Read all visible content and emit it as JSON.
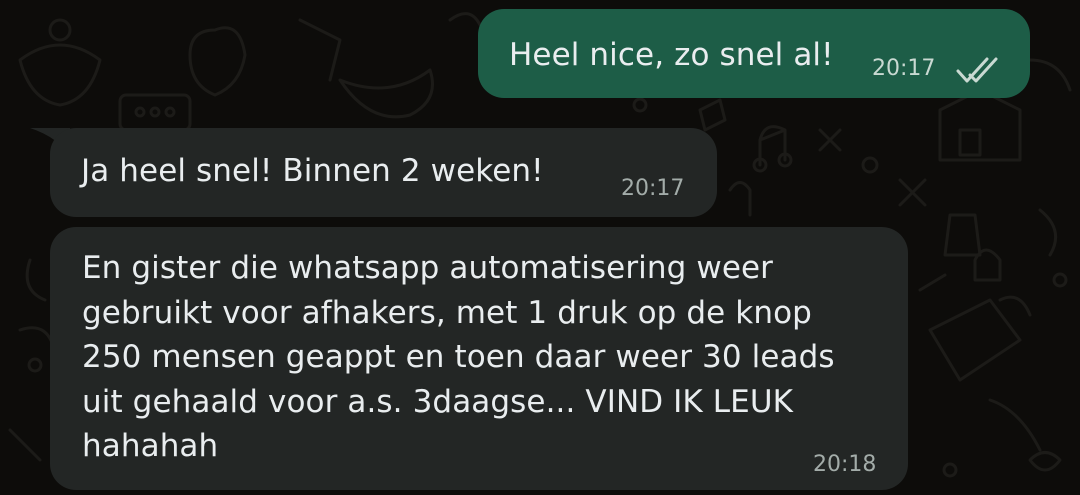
{
  "colors": {
    "background": "#0d0c0a",
    "outgoing_bubble": "#1d5d47",
    "incoming_bubble": "#232625",
    "text": "#e9edef",
    "timestamp": "#a3aca9",
    "read_ticks": "#c9d9d2"
  },
  "messages": [
    {
      "direction": "outgoing",
      "text": "Heel nice, zo snel al!",
      "time": "20:17",
      "status_icon": "double-check-icon"
    },
    {
      "direction": "incoming",
      "text": "Ja heel snel! Binnen 2 weken!",
      "time": "20:17"
    },
    {
      "direction": "incoming",
      "lines": [
        "En gister die whatsapp automatisering weer",
        "gebruikt voor afhakers, met 1 druk op de knop",
        "250 mensen geappt en toen daar weer 30 leads",
        "uit gehaald voor a.s. 3daagse... VIND IK LEUK",
        "hahahah"
      ],
      "time": "20:18"
    }
  ]
}
